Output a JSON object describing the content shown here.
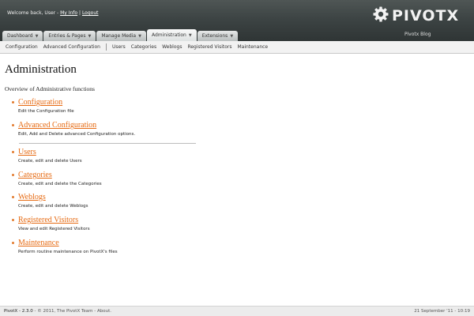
{
  "header": {
    "welcome_prefix": "Welcome back, User - ",
    "my_info": "My Info",
    "separator": " | ",
    "logout": "Logout",
    "logo_text": "PIVOTX",
    "logo_icon": "gear-icon",
    "blog_name": "Pivotx Blog",
    "background_color": "#3d4444"
  },
  "tabs": [
    {
      "label": "Dashboard",
      "has_dropdown": true
    },
    {
      "label": "Entries & Pages",
      "has_dropdown": true
    },
    {
      "label": "Manage Media",
      "has_dropdown": true
    },
    {
      "label": "Administration",
      "has_dropdown": true,
      "active": true
    },
    {
      "label": "Extensions",
      "has_dropdown": true
    }
  ],
  "subnav": {
    "items": [
      "Configuration",
      "Advanced Configuration",
      "Users",
      "Categories",
      "Weblogs",
      "Registered Visitors",
      "Maintenance"
    ]
  },
  "main": {
    "title": "Administration",
    "subtitle": "Overview of Administrative functions",
    "items": [
      {
        "title": "Configuration",
        "description": "Edit the Configuration file"
      },
      {
        "title": "Advanced Configuration",
        "description": "Edit, Add and Delete advanced Configuration options."
      },
      {
        "title": "Users",
        "description": "Create, edit and delete Users"
      },
      {
        "title": "Categories",
        "description": "Create, edit and delete the Categories"
      },
      {
        "title": "Weblogs",
        "description": "Create, edit and delete Weblogs"
      },
      {
        "title": "Registered Visitors",
        "description": "View and edit Registered Visitors"
      },
      {
        "title": "Maintenance",
        "description": "Perform routine maintenance on PivotX's files"
      }
    ],
    "link_color": "#e66a12"
  },
  "footer": {
    "version": "PivotX - 2.3.0",
    "copyright": " - © 2011, The PivotX Team - ",
    "about": "About",
    "about_suffix": ".",
    "datetime": "21 September '11 - 10:19"
  }
}
